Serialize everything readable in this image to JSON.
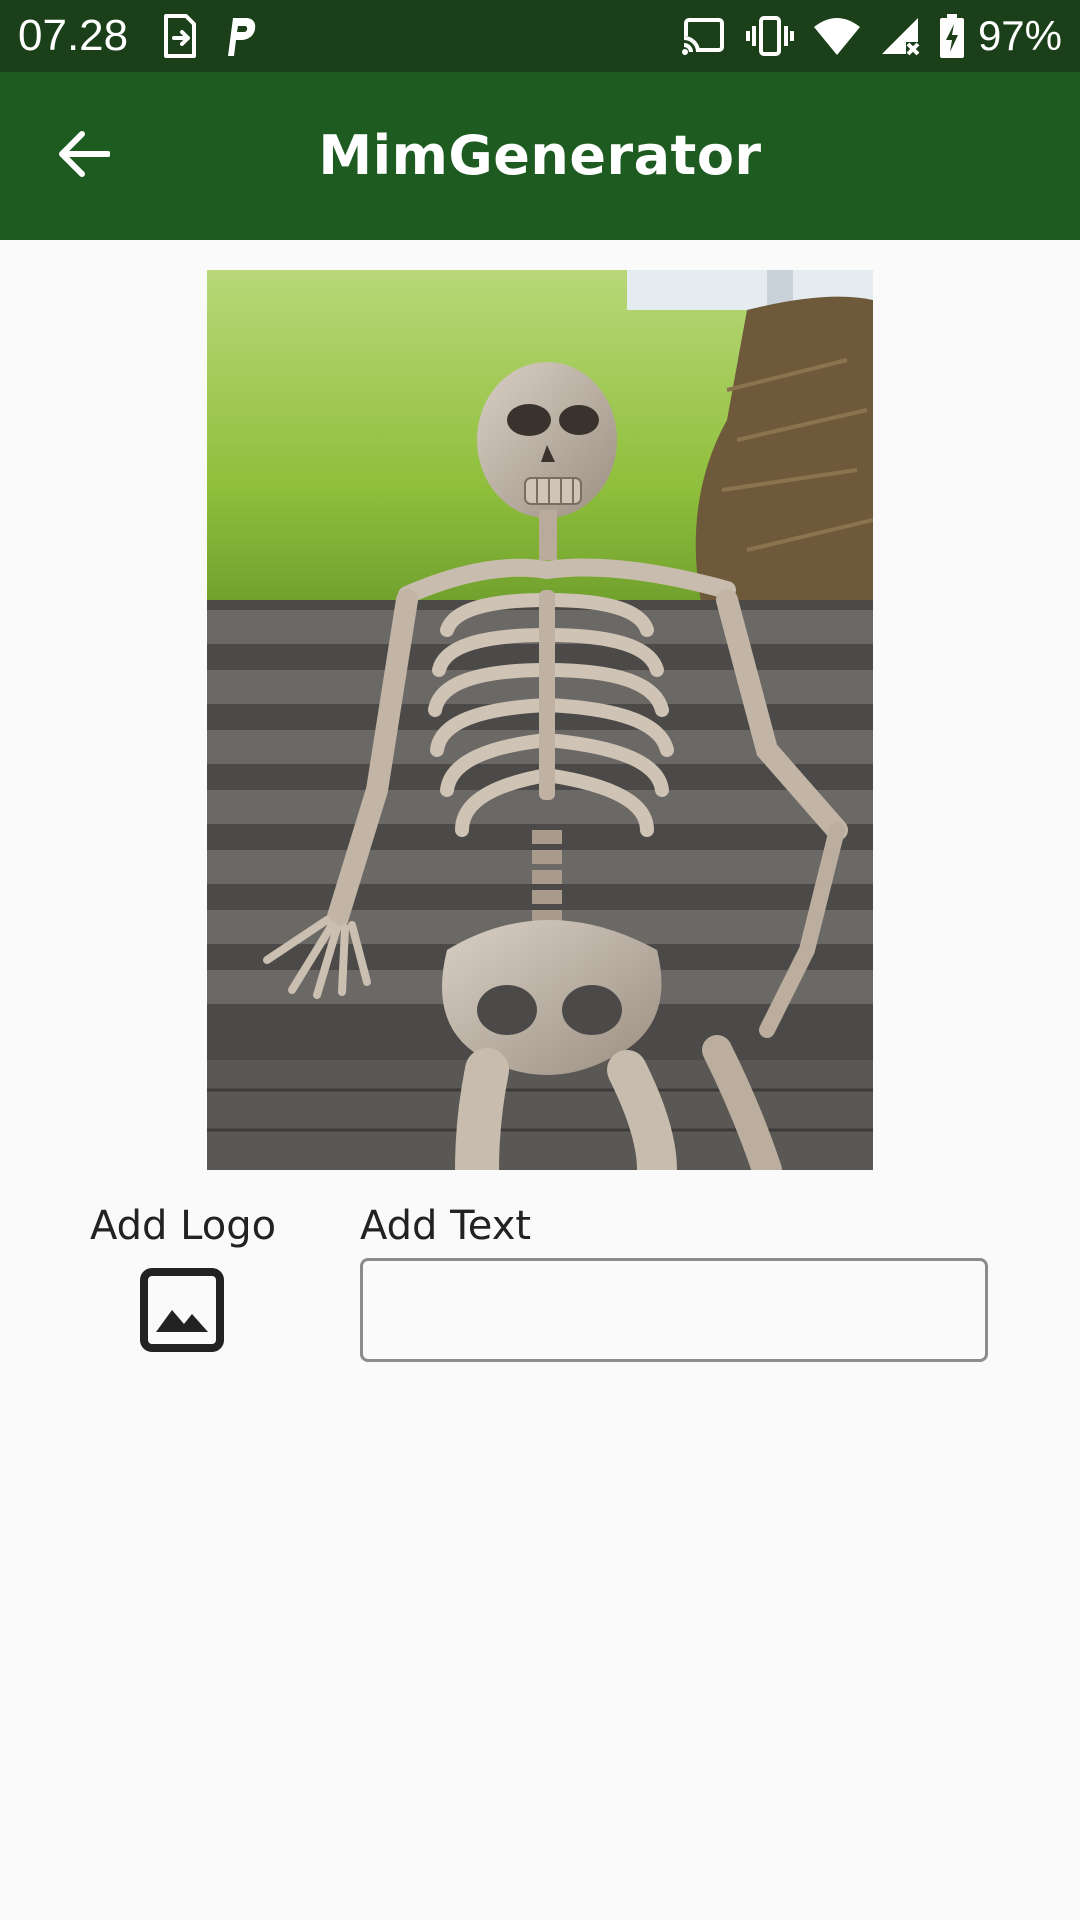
{
  "status_bar": {
    "time": "07.28",
    "battery": "97%",
    "left_icons": [
      "sim-transfer-icon",
      "parking-p-icon"
    ],
    "right_icons": [
      "cast-icon",
      "vibrate-icon",
      "wifi-icon",
      "cell-signal-no-data-icon",
      "battery-charging-icon"
    ]
  },
  "app_bar": {
    "title": "MimGenerator",
    "back_icon": "arrow-left-icon",
    "background": "#1d5b20",
    "status_background": "#1a3f19"
  },
  "meme": {
    "image": "skeleton-sitting-on-bench-photo"
  },
  "controls": {
    "add_logo_label": "Add Logo",
    "add_logo_icon": "image-icon",
    "add_text_label": "Add Text",
    "add_text_value": "",
    "add_text_placeholder": ""
  }
}
